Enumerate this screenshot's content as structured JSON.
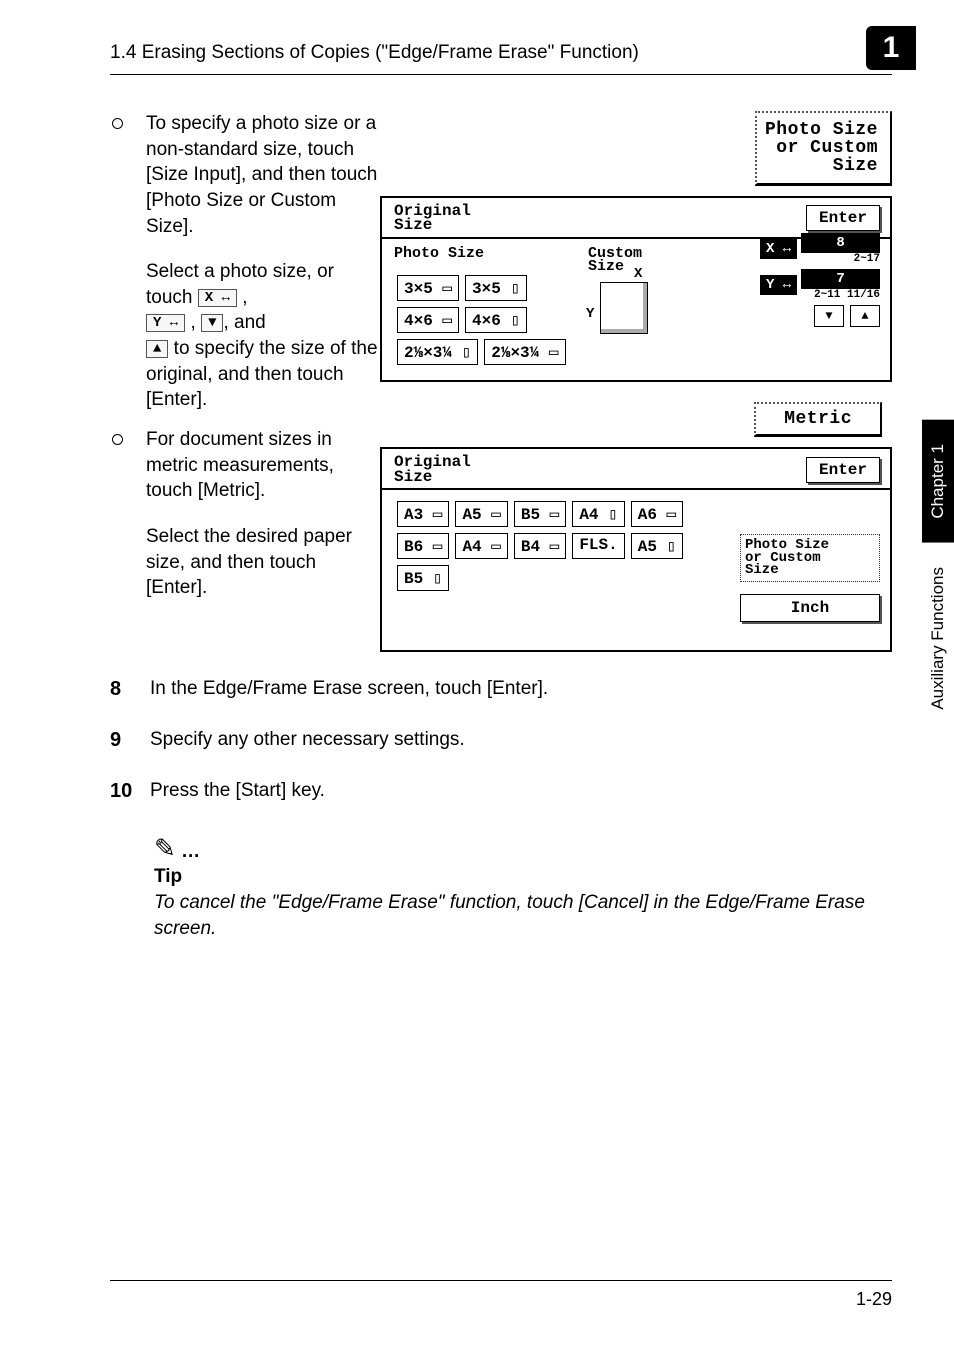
{
  "header": {
    "section_title": "1.4 Erasing Sections of Copies (\"Edge/Frame Erase\" Function)",
    "badge": "1"
  },
  "side_tabs": {
    "chapter": "Chapter 1",
    "topic": "Auxiliary Functions"
  },
  "bullets": {
    "b1": "To specify a photo size or a non-standard size, touch [Size Input], and then touch [Photo Size or Custom Size].",
    "b1_sub_pre": "Select a photo size, or touch ",
    "k_x": "X ↔",
    "b1_sub_mid1": " , ",
    "k_y": "Y ↔",
    "b1_sub_mid2": " , ",
    "k_down": "▼",
    "b1_sub_mid3": ", and ",
    "k_up": "▲",
    "b1_sub_post": " to specify the size of the original, and then touch [Enter].",
    "b2": "For document sizes in metric measurements, touch [Metric].",
    "b2_sub": "Select the desired paper size, and then touch [Enter]."
  },
  "lcd_photo_custom": {
    "line1": "Photo Size",
    "line2": "or  Custom",
    "line3": "Size"
  },
  "lcd1": {
    "title_l1": "Original",
    "title_l2": "Size",
    "enter": "Enter",
    "hdr_left": "Photo Size",
    "hdr_right_l1": "Custom",
    "hdr_right_l2": "Size",
    "buttons": [
      "3×5 ▭",
      "3×5 ▯",
      "4×6 ▭",
      "4×6 ▯",
      "2⅛×3¼ ▯",
      "2⅛×3¼ ▭"
    ],
    "axis_x": "X",
    "axis_y": "Y",
    "ctrl_x_label": "X ↔",
    "ctrl_x_val": "8",
    "ctrl_x_range": "2~17",
    "ctrl_y_label": "Y ↔",
    "ctrl_y_val": "7",
    "ctrl_y_range": "2~11 11/16",
    "arrow_down": "▼",
    "arrow_up": "▲"
  },
  "lcd_metric": {
    "label": "Metric"
  },
  "lcd2": {
    "title_l1": "Original",
    "title_l2": "Size",
    "enter": "Enter",
    "buttons": [
      "A3 ▭",
      "A5 ▭",
      "B5 ▭",
      "A4 ▯",
      "A6 ▭",
      "B6 ▭",
      "A4 ▭",
      "B4 ▭",
      "FLS.",
      "A5 ▯",
      "B5 ▯"
    ],
    "small_panel_l1": "Photo Size",
    "small_panel_l2": "or  Custom",
    "small_panel_l3": "Size",
    "inch": "Inch"
  },
  "steps": {
    "s8_num": "8",
    "s8": "In the Edge/Frame Erase screen, touch [Enter].",
    "s9_num": "9",
    "s9": "Specify any other necessary settings.",
    "s10_num": "10",
    "s10": "Press the [Start] key."
  },
  "tip": {
    "icon": "✎",
    "dots": "…",
    "label": "Tip",
    "text": "To cancel the \"Edge/Frame Erase\" function, touch [Cancel] in the Edge/Frame Erase screen."
  },
  "footer": {
    "page": "1-29"
  }
}
